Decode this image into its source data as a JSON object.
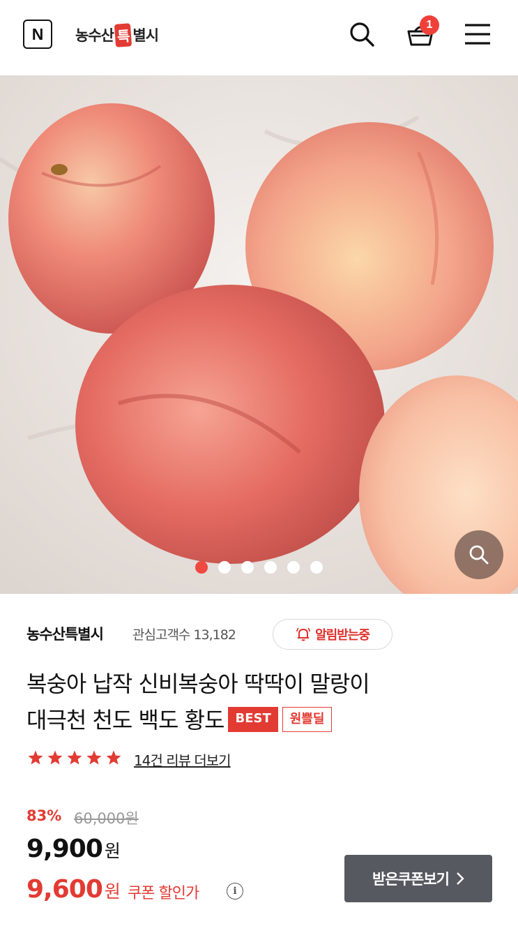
{
  "header": {
    "logo_letter": "N",
    "brand_prefix": "농수산",
    "brand_badge": "특",
    "brand_suffix": "별시",
    "cart_count": "1",
    "icons": {
      "search": "search-icon",
      "cart": "basket-icon",
      "menu": "hamburger-menu-icon"
    }
  },
  "gallery": {
    "slide_count": 6,
    "active_index": 0,
    "active_color": "#ef4a40",
    "zoom_icon": "magnifier-icon"
  },
  "product": {
    "store_name": "농수산특별시",
    "followers_label": "관심고객수",
    "followers_count": "13,182",
    "alarm_label": "알림받는중",
    "title_line1": "복숭아 납작 신비복숭아 딱딱이 말랑이",
    "title_line2": "대극천 천도 백도 황도",
    "tag_best": "BEST",
    "tag_deal": "원쁠딜",
    "rating_stars": 5,
    "review_link": "14건 리뷰 더보기",
    "discount_rate": "83%",
    "original_price": "60,000원",
    "sale_price": "9,900",
    "sale_price_unit": "원",
    "coupon_price": "9,600",
    "coupon_price_unit": "원",
    "coupon_price_label": "쿠폰 할인가",
    "coupon_button": "받은쿠폰보기",
    "accent_color": "#e23b33"
  }
}
